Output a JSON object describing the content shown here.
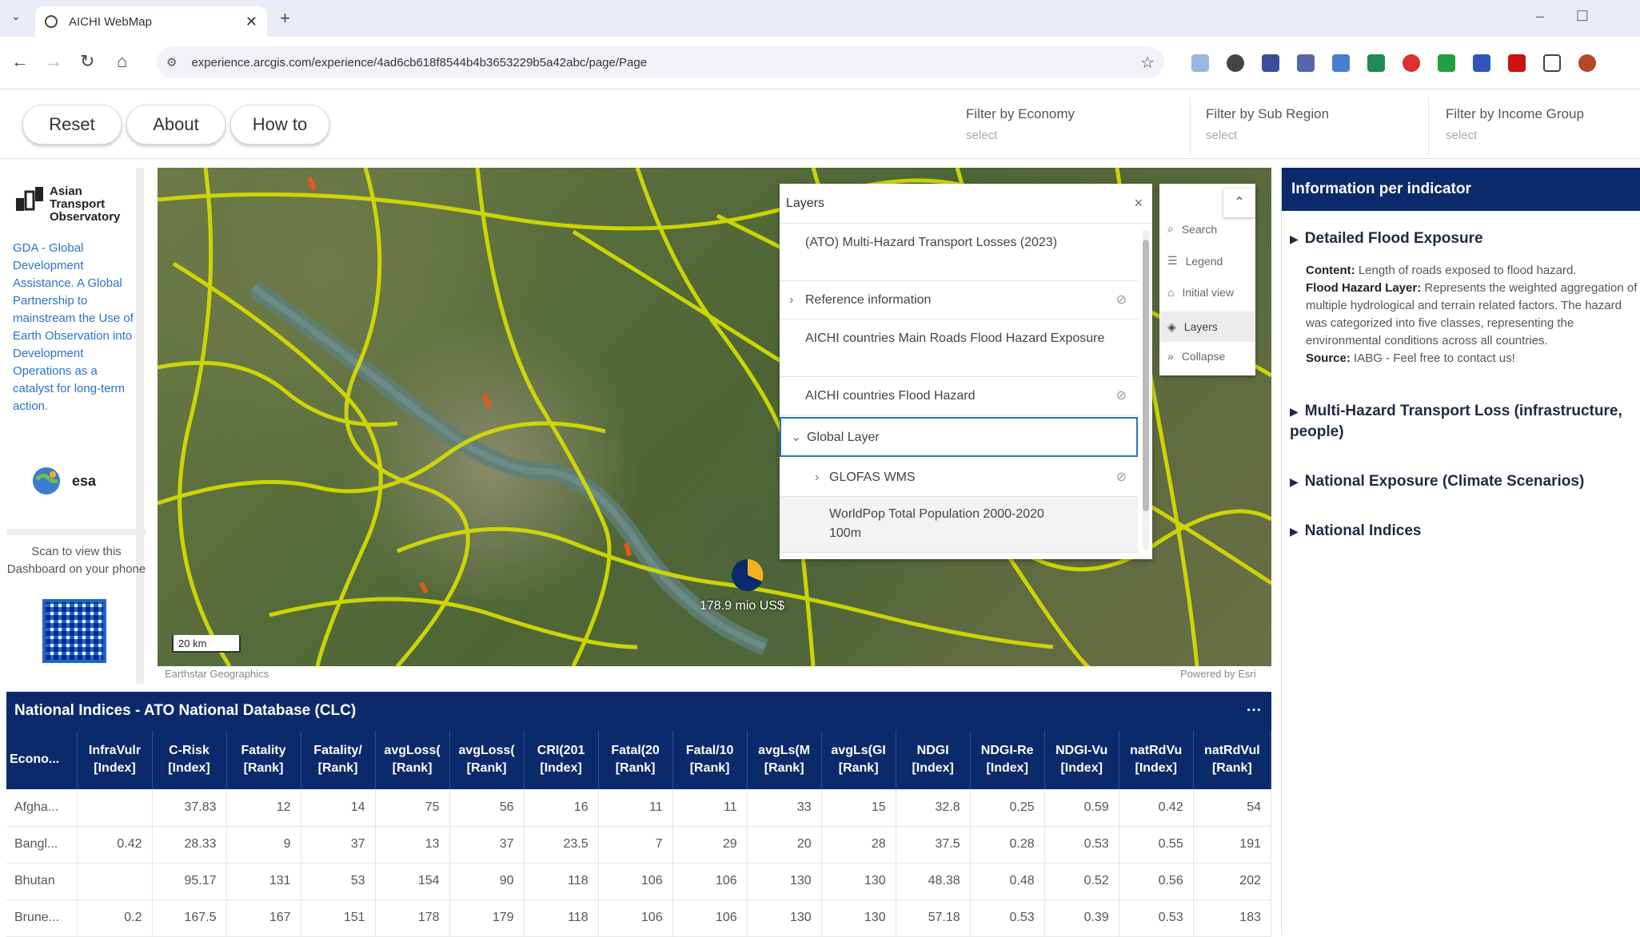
{
  "browser": {
    "tab_title": "AICHI WebMap",
    "tab_close": "✕",
    "new_tab": "+",
    "url": "experience.arcgis.com/experience/4ad6cb618f8544b4b3653229b5a42abc/page/Page"
  },
  "header": {
    "buttons": {
      "reset": "Reset",
      "about": "About",
      "how_to": "How to"
    },
    "filters": [
      {
        "label": "Filter by Economy",
        "value": "select"
      },
      {
        "label": "Filter by Sub Region",
        "value": "select"
      },
      {
        "label": "Filter by Income Group",
        "value": "select"
      }
    ]
  },
  "sidebar": {
    "logo_text": "Asian Transport Observatory",
    "gda_text": "GDA - Global Development Assistance. A Global Partnership to mainstream the Use of Earth Observation into Development Operations as a catalyst for long-term action.",
    "partner_esa": "esa",
    "scan_text": "Scan to view this Dashboard on your phone"
  },
  "map": {
    "attribution_left": "Earthstar Geographics",
    "attribution_right": "Powered by Esri",
    "scale": "20 km",
    "marker_label": "178.9 mio US$"
  },
  "layers_panel": {
    "title": "Layers",
    "close": "×",
    "items": [
      {
        "label": "(ATO) Multi-Hazard Transport Losses (2023)"
      },
      {
        "label": "Reference information"
      },
      {
        "label": "AICHI countries Main Roads Flood Hazard Exposure"
      },
      {
        "label": "AICHI countries Flood Hazard"
      },
      {
        "label": "Global Layer"
      },
      {
        "label": "GLOFAS WMS"
      },
      {
        "label": "WorldPop Total Population 2000-2020 100m"
      }
    ]
  },
  "map_tools": {
    "items": [
      {
        "label": "Search",
        "icon": "search-icon"
      },
      {
        "label": "Legend",
        "icon": "legend-icon"
      },
      {
        "label": "Initial view",
        "icon": "home-icon"
      },
      {
        "label": "Layers",
        "icon": "layers-icon"
      },
      {
        "label": "Collapse",
        "icon": "collapse-icon"
      }
    ]
  },
  "info_panel": {
    "title": "Information per indicator",
    "sections": [
      "Detailed Flood Exposure",
      "Multi-Hazard Transport Loss (infrastructure, people)",
      "National Exposure (Climate Scenarios)",
      "National Indices"
    ],
    "content_label": "Content:",
    "content_text": "Length of roads exposed to flood hazard.",
    "layer_label": "Flood Hazard Layer:",
    "layer_text": "Represents the weighted aggregation of multiple hydrological and terrain related factors. The hazard was categorized into five classes, representing the environmental conditions across all countries.",
    "source_label": "Source:",
    "source_text": "IABG - Feel free to contact us!"
  },
  "table": {
    "title": "National Indices - ATO National Database (CLC)",
    "more": "···",
    "columns": [
      [
        "Econo...",
        ""
      ],
      [
        "InfraVulr",
        "[Index]"
      ],
      [
        "C-Risk",
        "[Index]"
      ],
      [
        "Fatality",
        "[Rank]"
      ],
      [
        "Fatality/",
        "[Rank]"
      ],
      [
        "avgLoss(",
        "[Rank]"
      ],
      [
        "avgLoss(",
        "[Rank]"
      ],
      [
        "CRI(201",
        "[Index]"
      ],
      [
        "Fatal(20",
        "[Rank]"
      ],
      [
        "Fatal/10",
        "[Rank]"
      ],
      [
        "avgLs(M",
        "[Rank]"
      ],
      [
        "avgLs(GI",
        "[Rank]"
      ],
      [
        "NDGI",
        "[Index]"
      ],
      [
        "NDGI-Re",
        "[Index]"
      ],
      [
        "NDGI-Vu",
        "[Index]"
      ],
      [
        "natRdVu",
        "[Index]"
      ],
      [
        "natRdVul",
        "[Rank]"
      ]
    ],
    "rows": [
      [
        "Afgha...",
        "",
        "37.83",
        "12",
        "14",
        "75",
        "56",
        "16",
        "11",
        "11",
        "33",
        "15",
        "32.8",
        "0.25",
        "0.59",
        "0.42",
        "54"
      ],
      [
        "Bangl...",
        "0.42",
        "28.33",
        "9",
        "37",
        "13",
        "37",
        "23.5",
        "7",
        "29",
        "20",
        "28",
        "37.5",
        "0.28",
        "0.53",
        "0.55",
        "191"
      ],
      [
        "Bhutan",
        "",
        "95.17",
        "131",
        "53",
        "154",
        "90",
        "118",
        "106",
        "106",
        "130",
        "130",
        "48.38",
        "0.48",
        "0.52",
        "0.56",
        "202"
      ],
      [
        "Brune...",
        "0.2",
        "167.5",
        "167",
        "151",
        "178",
        "179",
        "118",
        "106",
        "106",
        "130",
        "130",
        "57.18",
        "0.53",
        "0.39",
        "0.53",
        "183"
      ]
    ]
  },
  "colors": {
    "navy": "#0b2a6b",
    "road_yellow": "#e8e000",
    "link_blue": "#2a72c8"
  }
}
